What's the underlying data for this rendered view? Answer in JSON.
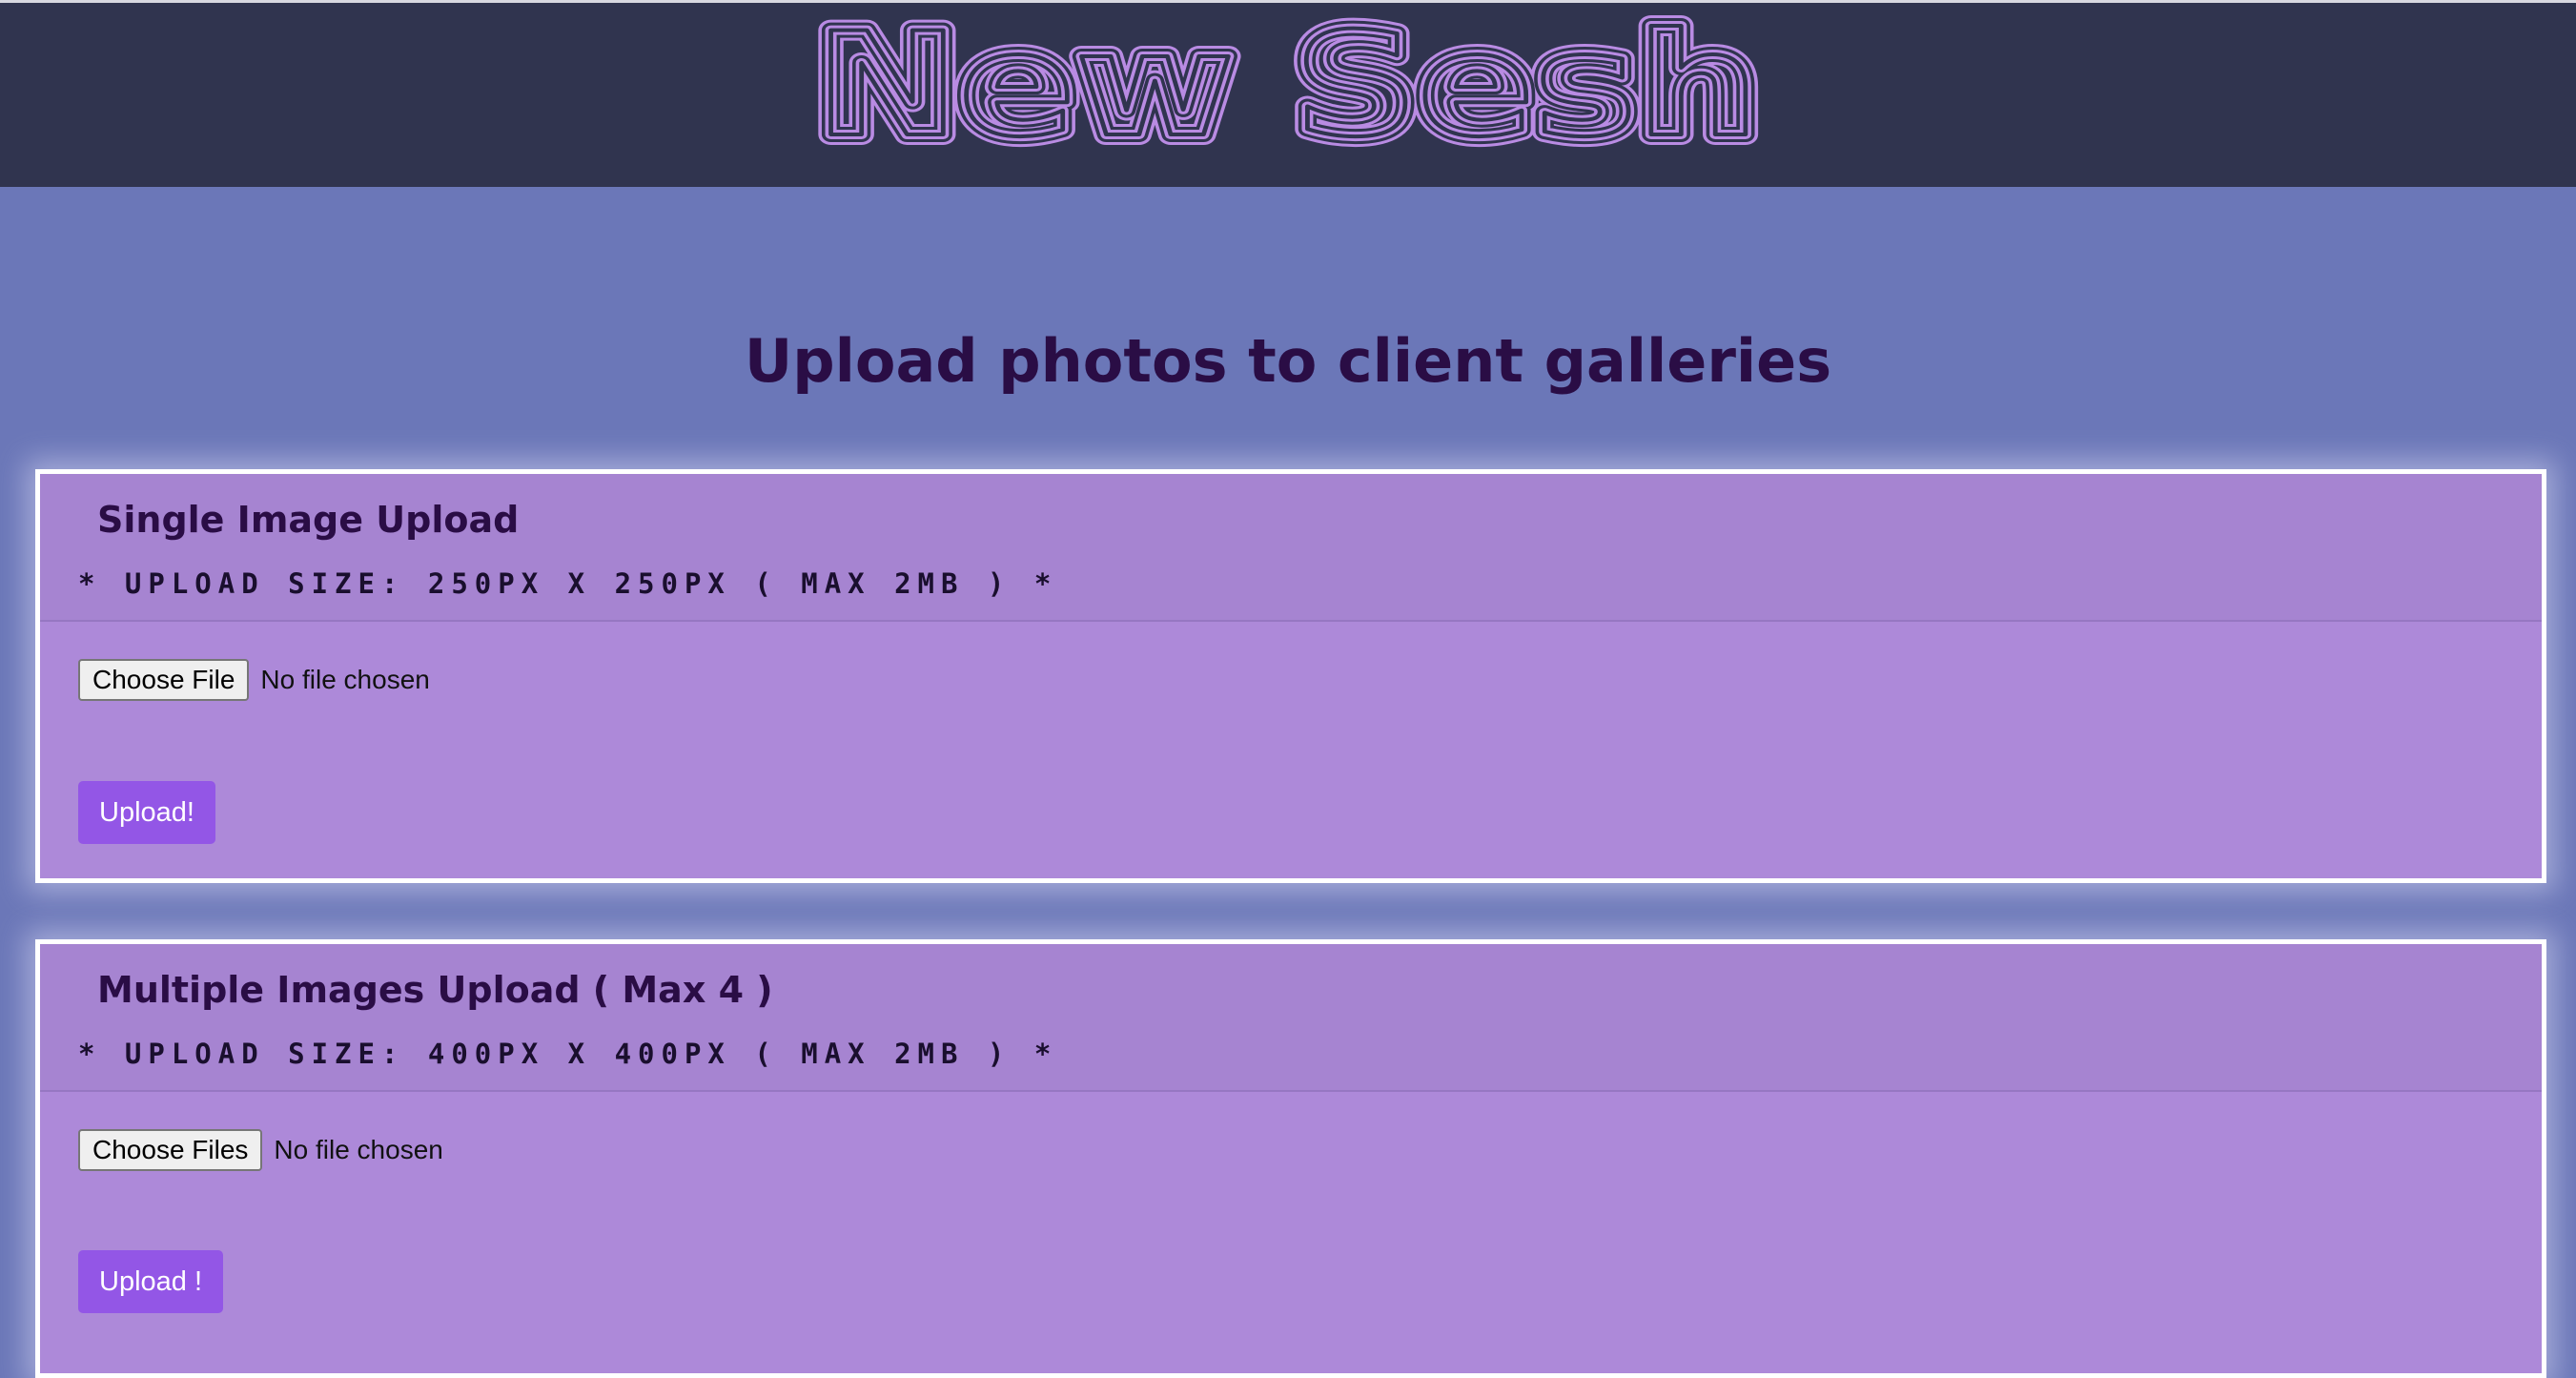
{
  "header": {
    "logo_text": "New Sesh"
  },
  "page": {
    "title": "Upload photos to client galleries"
  },
  "single_upload": {
    "title": "Single Image Upload",
    "note": "* UPLOAD SIZE: 250PX X 250PX ( MAX 2MB ) *",
    "choose_label": "Choose File",
    "file_status": "No file chosen",
    "upload_label": "Upload!"
  },
  "multiple_upload": {
    "title": "Multiple Images Upload ( Max 4 )",
    "note": "* UPLOAD SIZE: 400PX X 400PX ( MAX 2MB ) *",
    "choose_label": "Choose Files",
    "file_status": "No file chosen",
    "upload_label": "Upload !"
  },
  "colors": {
    "header_bg": "#30344f",
    "page_bg": "#6b77b8",
    "panel_bg": "#ad89d9",
    "logo_stroke": "#b98be3",
    "accent_button": "#9356e6",
    "title_text": "#2a0d45"
  }
}
